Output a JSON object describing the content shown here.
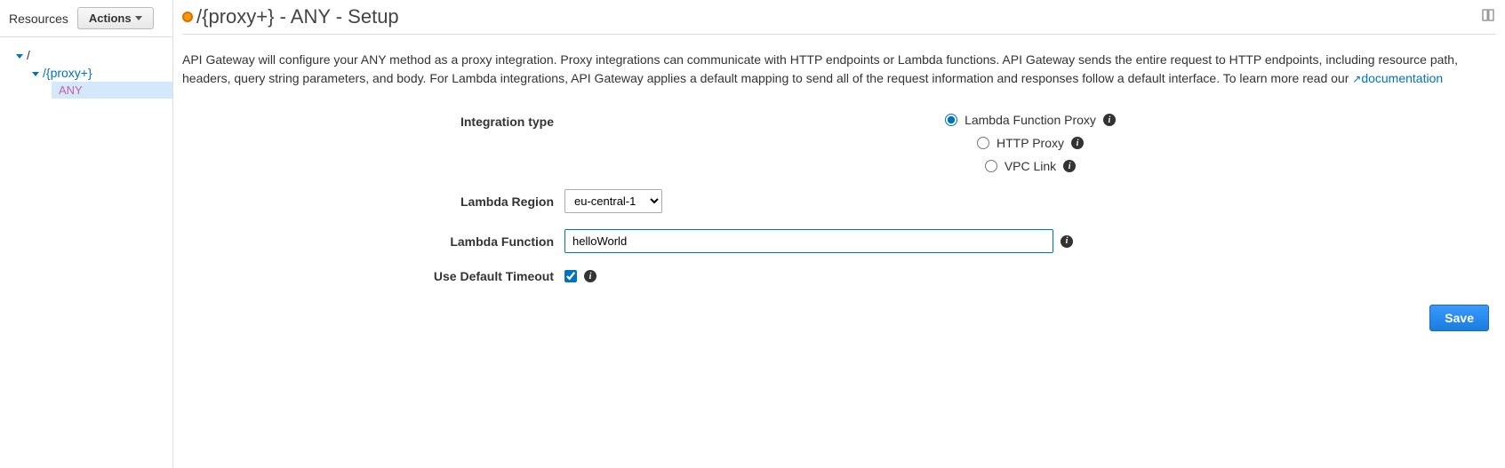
{
  "sidebar": {
    "title": "Resources",
    "actions_label": "Actions",
    "tree": {
      "root": "/",
      "proxy": "/{proxy+}",
      "method": "ANY"
    }
  },
  "header": {
    "title": "/{proxy+} - ANY - Setup"
  },
  "description": {
    "text": "API Gateway will configure your ANY method as a proxy integration. Proxy integrations can communicate with HTTP endpoints or Lambda functions. API Gateway sends the entire request to HTTP endpoints, including resource path, headers, query string parameters, and body. For Lambda integrations, API Gateway applies a default mapping to send all of the request information and responses follow a default interface. To learn more read our ",
    "link_label": "documentation"
  },
  "form": {
    "integration_type": {
      "label": "Integration type",
      "options": {
        "lambda": "Lambda Function Proxy",
        "http": "HTTP Proxy",
        "vpc": "VPC Link"
      },
      "selected": "lambda"
    },
    "lambda_region": {
      "label": "Lambda Region",
      "value": "eu-central-1"
    },
    "lambda_function": {
      "label": "Lambda Function",
      "value": "helloWorld"
    },
    "default_timeout": {
      "label": "Use Default Timeout",
      "checked": true
    },
    "save_label": "Save"
  }
}
